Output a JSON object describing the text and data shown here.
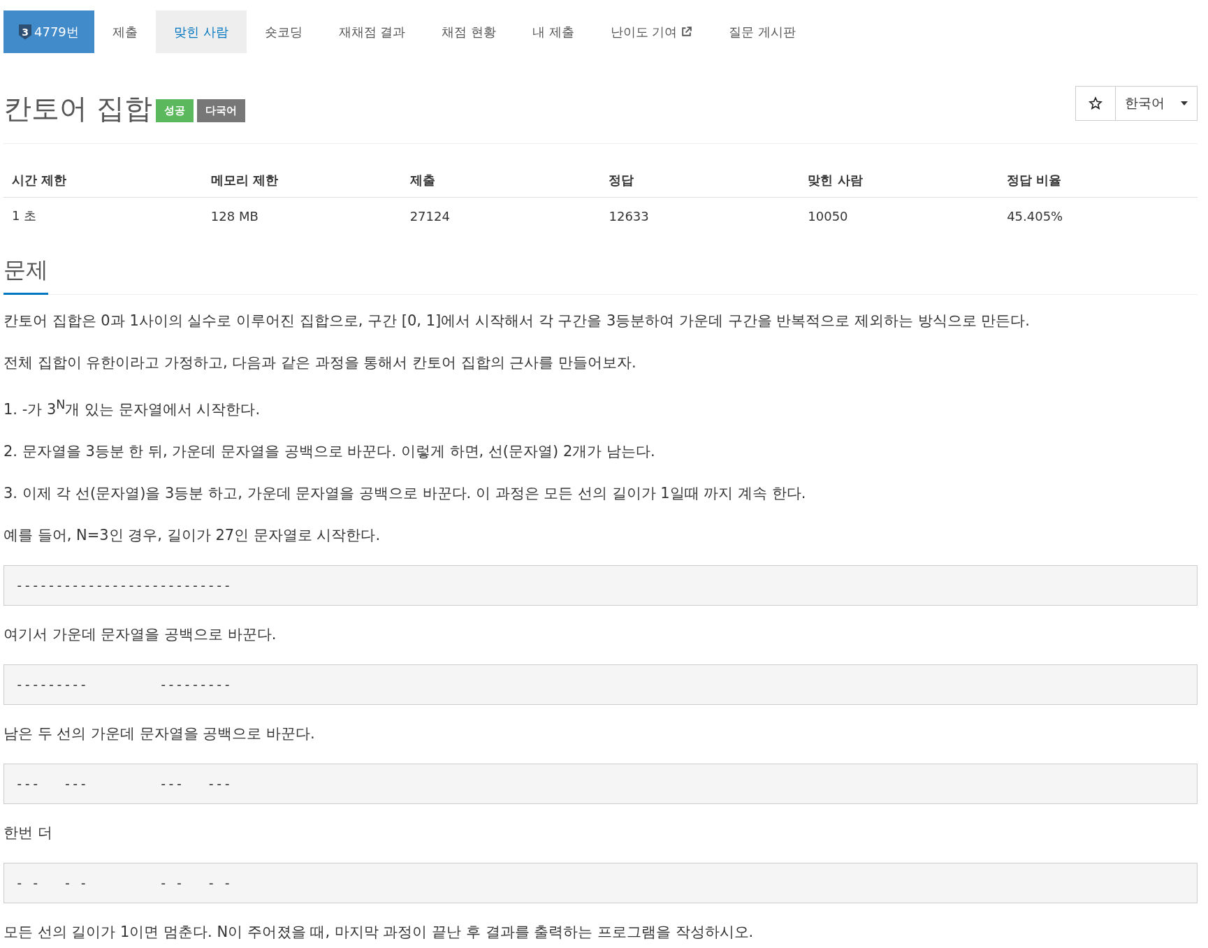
{
  "nav": {
    "tabs": [
      {
        "label": "4779번",
        "kind": "problem",
        "badge": "3",
        "selected": false
      },
      {
        "label": "제출",
        "kind": "plain",
        "selected": false
      },
      {
        "label": "맞힌 사람",
        "kind": "plain",
        "selected": true
      },
      {
        "label": "숏코딩",
        "kind": "plain",
        "selected": false
      },
      {
        "label": "재채점 결과",
        "kind": "plain",
        "selected": false
      },
      {
        "label": "채점 현황",
        "kind": "plain",
        "selected": false
      },
      {
        "label": "내 제출",
        "kind": "plain",
        "selected": false
      },
      {
        "label": "난이도 기여",
        "kind": "external",
        "selected": false
      },
      {
        "label": "질문 게시판",
        "kind": "plain",
        "selected": false
      }
    ]
  },
  "title": "칸토어 집합",
  "labels": [
    {
      "text": "성공",
      "color": "#5cb85c"
    },
    {
      "text": "다국어",
      "color": "#777777"
    }
  ],
  "language": "한국어",
  "info_table": {
    "columns": [
      "시간 제한",
      "메모리 제한",
      "제출",
      "정답",
      "맞힌 사람",
      "정답 비율"
    ],
    "rows": [
      [
        "1 초",
        "128 MB",
        "27124",
        "12633",
        "10050",
        "45.405%"
      ]
    ]
  },
  "section_title": "문제",
  "body": [
    {
      "kind": "text",
      "text": "칸토어 집합은 0과 1사이의 실수로 이루어진 집합으로, 구간 [0, 1]에서 시작해서 각 구간을 3등분하여 가운데 구간을 반복적으로 제외하는 방식으로 만든다."
    },
    {
      "kind": "text",
      "text": "전체 집합이 유한이라고 가정하고, 다음과 같은 과정을 통해서 칸토어 집합의 근사를 만들어보자."
    },
    {
      "kind": "text",
      "text": "1. -가 3$^{N}$개 있는 문자열에서 시작한다."
    },
    {
      "kind": "text",
      "text": "2. 문자열을 3등분 한 뒤, 가운데 문자열을 공백으로 바꾼다. 이렇게 하면, 선(문자열) 2개가 남는다."
    },
    {
      "kind": "text",
      "text": "3. 이제 각 선(문자열)을 3등분 하고, 가운데 문자열을 공백으로 바꾼다. 이 과정은 모든 선의 길이가 1일때 까지 계속 한다."
    },
    {
      "kind": "text",
      "text": "예를 들어, N=3인 경우, 길이가 27인 문자열로 시작한다."
    },
    {
      "kind": "code",
      "text": "---------------------------"
    },
    {
      "kind": "text",
      "text": "여기서 가운데 문자열을 공백으로 바꾼다."
    },
    {
      "kind": "code",
      "text": "---------         ---------"
    },
    {
      "kind": "text",
      "text": "남은 두 선의 가운데 문자열을 공백으로 바꾼다."
    },
    {
      "kind": "code",
      "text": "---   ---         ---   ---"
    },
    {
      "kind": "text",
      "text": "한번 더"
    },
    {
      "kind": "code",
      "text": "- -   - -         - -   - -"
    },
    {
      "kind": "text",
      "text": "모든 선의 길이가 1이면 멈춘다. N이 주어졌을 때, 마지막 과정이 끝난 후 결과를 출력하는 프로그램을 작성하시오."
    }
  ]
}
